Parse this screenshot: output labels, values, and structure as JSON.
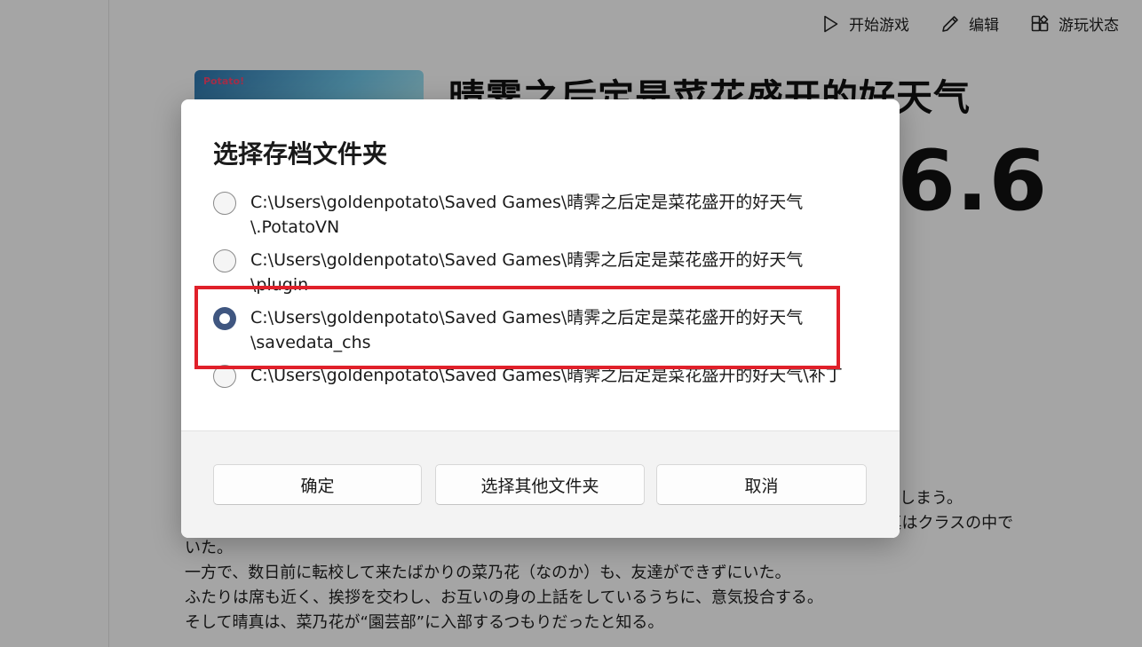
{
  "toolbar": {
    "start_label": "开始游戏",
    "edit_label": "编辑",
    "status_label": "游玩状态",
    "start_icon": "play-icon",
    "edit_icon": "pencil-icon",
    "status_icon": "status-icon"
  },
  "game": {
    "title": "晴霁之后定是菜花盛开的好天气",
    "rating": "6.6",
    "cover_logo": "Potato!"
  },
  "description": {
    "lines": [
      "しまう。",
      "晴真の病気が完治して学園に復帰したものの、クラス替えをしたクラスメイトたちと馴染めず、晴真はクラスの中で",
      "いた。",
      "一方で、数日前に転校して来たばかりの菜乃花（なのか）も、友達ができずにいた。",
      "ふたりは席も近く、挨拶を交わし、お互いの身の上話をしているうちに、意気投合する。",
      "そして晴真は、菜乃花が“園芸部”に入部するつもりだったと知る。"
    ]
  },
  "dialog": {
    "title": "选择存档文件夹",
    "options": [
      {
        "line1": "C:\\Users\\goldenpotato\\Saved Games\\晴霁之后定是菜花盛开的好天气",
        "line2": "\\.PotatoVN",
        "selected": false
      },
      {
        "line1": "C:\\Users\\goldenpotato\\Saved Games\\晴霁之后定是菜花盛开的好天气",
        "line2": "\\plugin",
        "selected": false
      },
      {
        "line1": "C:\\Users\\goldenpotato\\Saved Games\\晴霁之后定是菜花盛开的好天气",
        "line2": "\\savedata_chs",
        "selected": true
      },
      {
        "line1": "C:\\Users\\goldenpotato\\Saved Games\\晴霁之后定是菜花盛开的好天气\\补丁",
        "line2": "",
        "selected": false
      }
    ],
    "buttons": {
      "confirm": "确定",
      "other_folder": "选择其他文件夹",
      "cancel": "取消"
    }
  },
  "colors": {
    "accent": "#3f5680",
    "highlight": "#e0202a"
  }
}
